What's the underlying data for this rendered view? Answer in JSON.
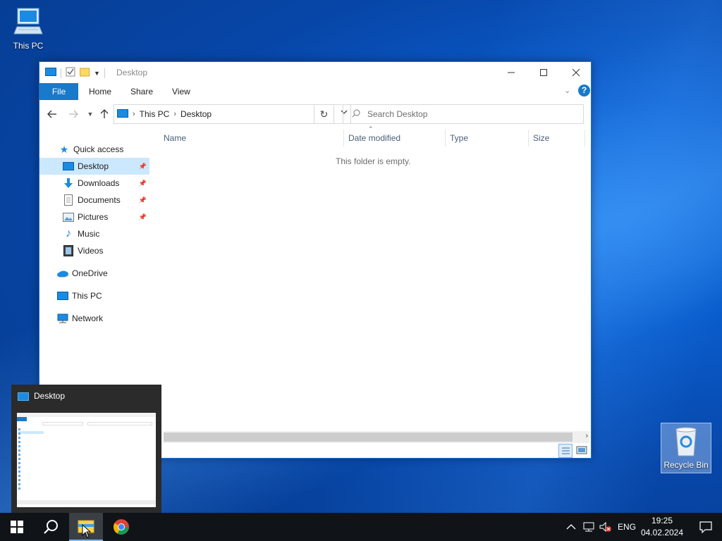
{
  "desktop": {
    "icons": [
      {
        "label": "This PC"
      },
      {
        "label": "Recycle Bin"
      }
    ]
  },
  "window": {
    "title": "Desktop",
    "ribbon_tabs": [
      "File",
      "Home",
      "Share",
      "View"
    ],
    "breadcrumb": [
      "This PC",
      "Desktop"
    ],
    "search_placeholder": "Search Desktop",
    "nav_pane": {
      "quick_access": "Quick access",
      "quick_items": [
        "Desktop",
        "Downloads",
        "Documents",
        "Pictures",
        "Music",
        "Videos"
      ],
      "onedrive": "OneDrive",
      "this_pc": "This PC",
      "network": "Network"
    },
    "columns": [
      "Name",
      "Date modified",
      "Type",
      "Size"
    ],
    "empty_message": "This folder is empty."
  },
  "thumbnail": {
    "title": "Desktop"
  },
  "taskbar": {
    "language": "ENG",
    "time": "19:25",
    "date": "04.02.2024"
  },
  "colors": {
    "accent": "#1979ca",
    "selection": "#cce8ff",
    "taskbar": "#101418"
  }
}
